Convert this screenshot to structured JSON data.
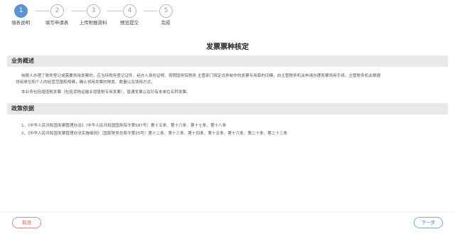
{
  "wizard": {
    "steps": [
      {
        "num": "1",
        "label": "填表说明",
        "active": true
      },
      {
        "num": "2",
        "label": "填写申请表",
        "active": false
      },
      {
        "num": "3",
        "label": "上传附报资料",
        "active": false
      },
      {
        "num": "4",
        "label": "预览提交",
        "active": false
      },
      {
        "num": "5",
        "label": "完成",
        "active": false
      }
    ]
  },
  "page": {
    "title": "发票票种核定"
  },
  "overview": {
    "heading": "业务概述",
    "para1_line1": "纳税人办理了税务登记或需要领用发票的，应当持税务登记证件、经办人身份证明、按照国务院税务 主管部门规定式样制作的发票专用章的印模，向主管税务机关申请办理发票领用手续。主管税务机关根据",
    "para1_line2": "领用单位和个人的经营范围和规模，确认领用发票的种类、数量以及领用方式。",
    "para2": "本业务包括增值税发票（包括货物运输业增值税专用发票）、普通发票以及印有本单位名称发票。"
  },
  "policy": {
    "heading": "政策依据",
    "items": [
      "1、《中华人民共和国发票管理办法》（中华人民共和国国务院令第587号）第十五条、第十六条、第十七条、第十八条",
      "2、《中华人民共和国发票管理办法实施细则》（国家税务总局令第25号）第十二条、第十三条、第十四条、第十五条、第十六条、第二十条、第二十三条"
    ]
  },
  "footer": {
    "cancel_label": "取消",
    "next_label": "下一步"
  },
  "colors": {
    "accent": "#5b93d3",
    "cancel": "#d5594b",
    "section_bg": "#e9e9e9"
  }
}
